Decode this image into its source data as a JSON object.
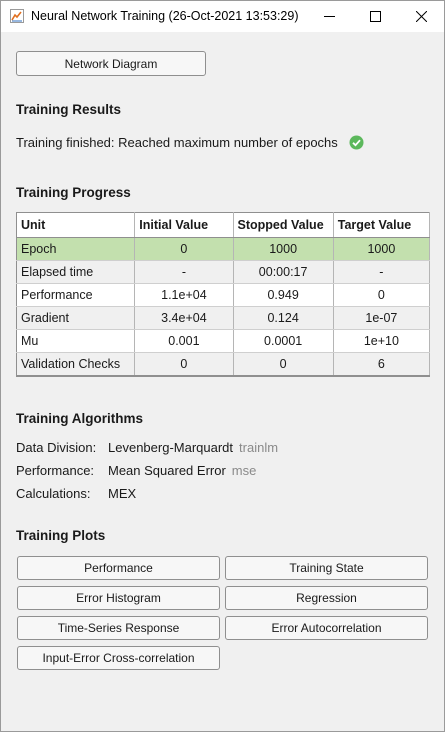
{
  "window": {
    "title": "Neural Network Training (26-Oct-2021 13:53:29)"
  },
  "buttons": {
    "network_diagram": "Network Diagram"
  },
  "results": {
    "heading": "Training Results",
    "status": "Training finished: Reached maximum number of epochs"
  },
  "progress": {
    "heading": "Training Progress",
    "columns": [
      "Unit",
      "Initial Value",
      "Stopped Value",
      "Target Value"
    ],
    "rows": [
      [
        "Epoch",
        "0",
        "1000",
        "1000"
      ],
      [
        "Elapsed time",
        "-",
        "00:00:17",
        "-"
      ],
      [
        "Performance",
        "1.1e+04",
        "0.949",
        "0"
      ],
      [
        "Gradient",
        "3.4e+04",
        "0.124",
        "1e-07"
      ],
      [
        "Mu",
        "0.001",
        "0.0001",
        "1e+10"
      ],
      [
        "Validation Checks",
        "0",
        "0",
        "6"
      ]
    ],
    "highlight_color": "#c3e0ae"
  },
  "algorithms": {
    "heading": "Training Algorithms",
    "items": [
      {
        "label": "Data Division:",
        "value": "Levenberg-Marquardt",
        "code": "trainlm"
      },
      {
        "label": "Performance:",
        "value": "Mean Squared Error",
        "code": "mse"
      },
      {
        "label": "Calculations:",
        "value": "MEX",
        "code": ""
      }
    ]
  },
  "plots": {
    "heading": "Training Plots",
    "buttons": [
      "Performance",
      "Training State",
      "Error Histogram",
      "Regression",
      "Time-Series Response",
      "Error Autocorrelation",
      "Input-Error Cross-correlation"
    ]
  },
  "colors": {
    "success": "#5cb85c",
    "accent_icon": "#e07020"
  }
}
